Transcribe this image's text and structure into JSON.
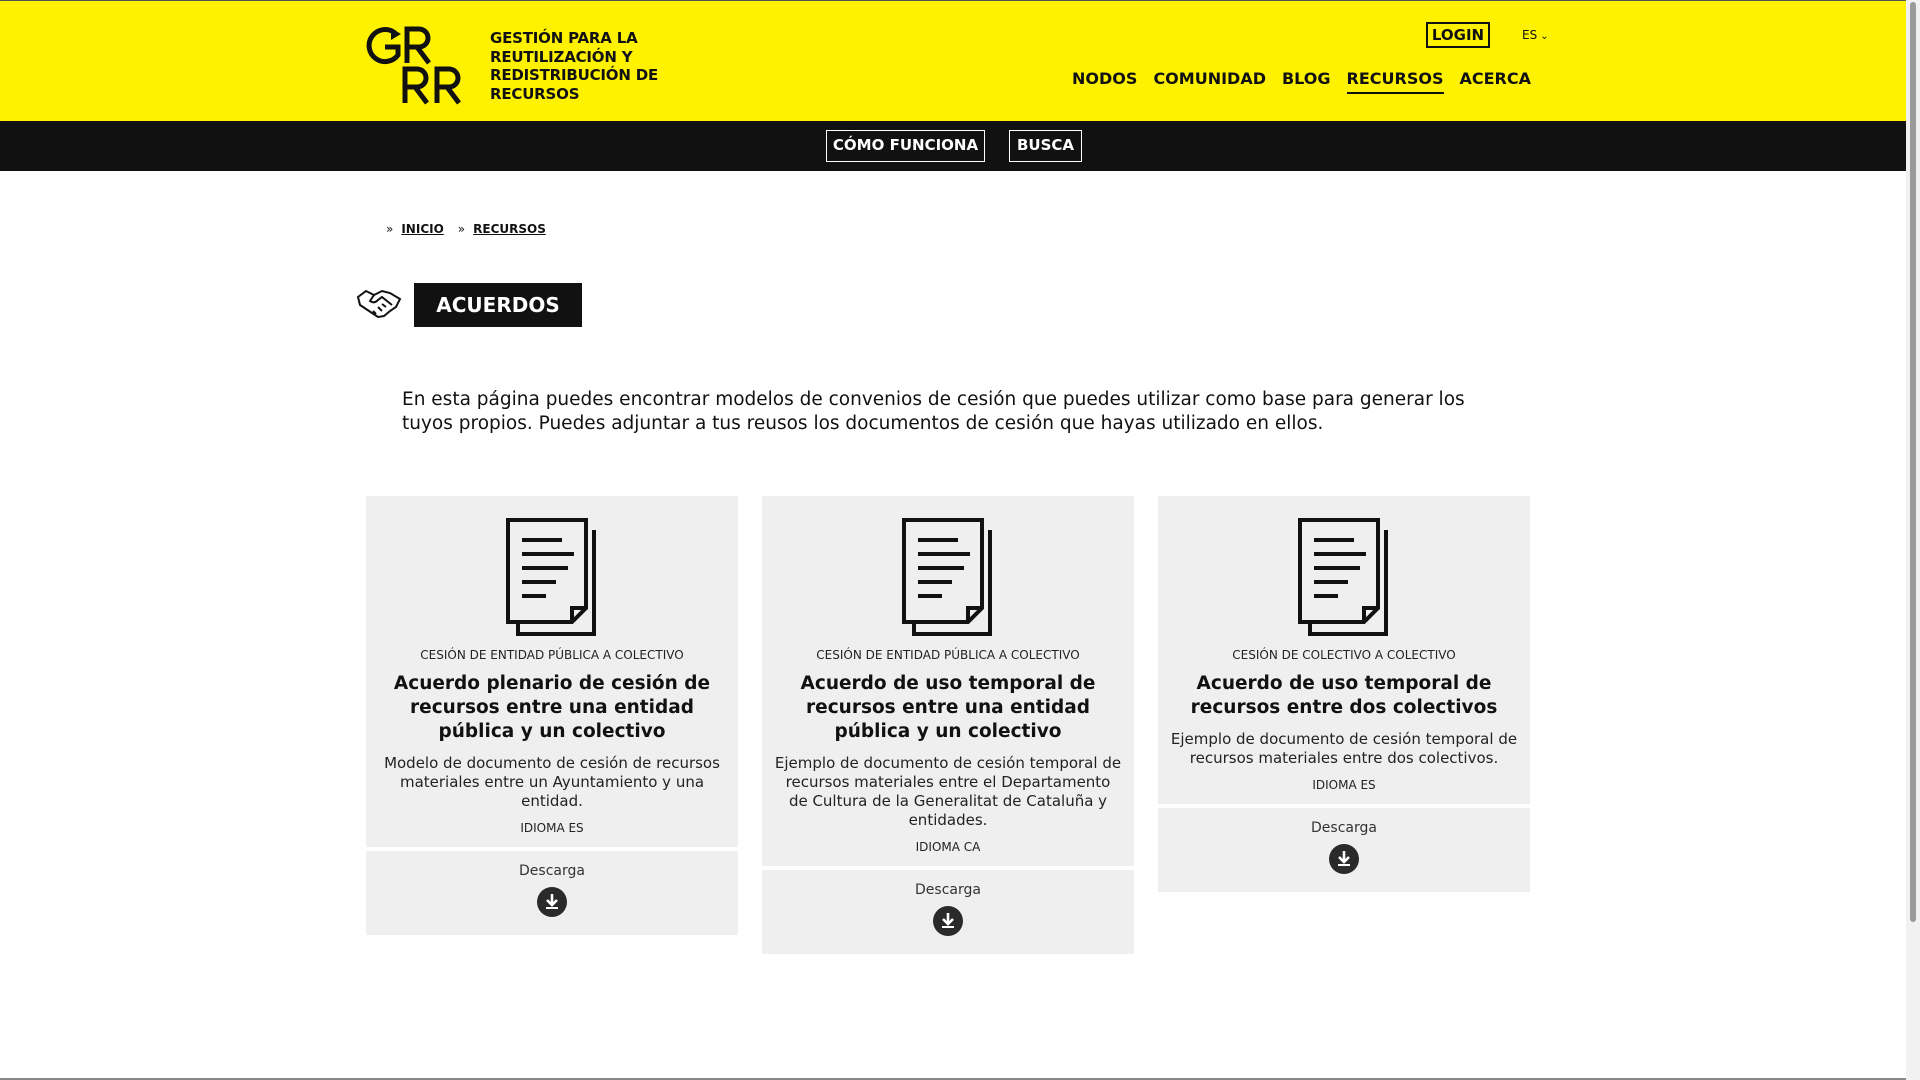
{
  "header": {
    "logo_text": "GRRR",
    "tagline": "GESTIÓN PARA LA REUTILIZACIÓN Y REDISTRIBUCIÓN DE RECURSOS",
    "login_label": "LOGIN",
    "language": "ES",
    "nav": [
      {
        "label": "NODOS"
      },
      {
        "label": "COMUNIDAD"
      },
      {
        "label": "BLOG"
      },
      {
        "label": "RECURSOS"
      },
      {
        "label": "ACERCA"
      }
    ]
  },
  "subnav": {
    "how_label": "CÓMO FUNCIONA",
    "search_label": "BUSCA"
  },
  "breadcrumb": {
    "items": [
      {
        "label": "INICIO"
      },
      {
        "label": "RECURSOS"
      }
    ]
  },
  "page": {
    "title": "ACUERDOS",
    "intro": "En esta página puedes encontrar modelos de convenios de cesión que puedes utilizar como base para generar los tuyos propios. Puedes adjuntar a tus reusos los documentos de cesión que hayas utilizado en ellos."
  },
  "cards": [
    {
      "category": "CESIÓN DE ENTIDAD PÚBLICA A COLECTIVO",
      "title": "Acuerdo plenario de cesión de recursos entre una entidad pública y un colectivo",
      "description": "Modelo de documento de cesión de recursos materiales entre un Ayuntamiento y una entidad.",
      "language": "IDIOMA ES",
      "download_label": "Descarga"
    },
    {
      "category": "CESIÓN DE ENTIDAD PÚBLICA A COLECTIVO",
      "title": "Acuerdo de uso temporal de recursos entre una entidad pública y un colectivo",
      "description": "Ejemplo de documento de cesión temporal de recursos materiales entre el Departamento de Cultura de la Generalitat de Cataluña y entidades.",
      "language": "IDIOMA CA",
      "download_label": "Descarga"
    },
    {
      "category": "CESIÓN DE COLECTIVO A COLECTIVO",
      "title": "Acuerdo de uso temporal de recursos entre dos colectivos",
      "description": "Ejemplo de documento de cesión temporal de recursos materiales entre dos colectivos.",
      "language": "IDIOMA ES",
      "download_label": "Descarga"
    }
  ],
  "colors": {
    "brand_yellow": "#fff200",
    "dark": "#111111",
    "card_bg": "#efefef"
  },
  "icons": {
    "title_icon": "handshake-icon",
    "card_icon": "document-icon",
    "download_icon": "download-icon",
    "language_chevron": "chevron-down-icon"
  }
}
